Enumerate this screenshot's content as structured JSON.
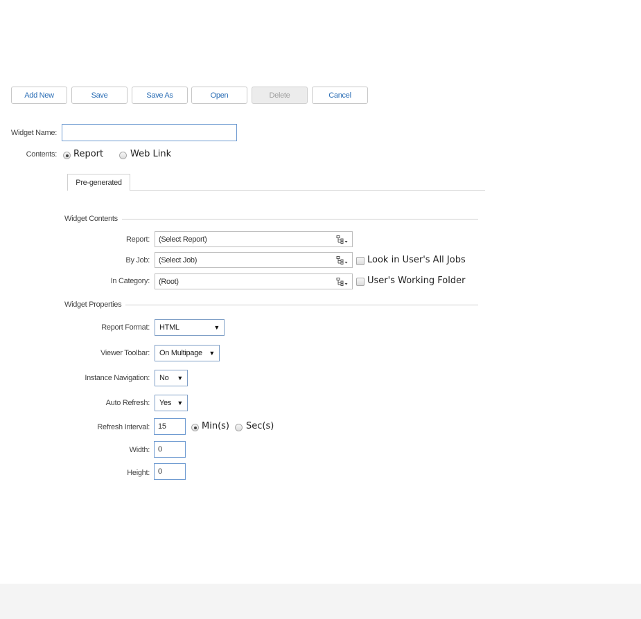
{
  "toolbar": {
    "add_new": "Add New",
    "save": "Save",
    "save_as": "Save As",
    "open": "Open",
    "delete": "Delete",
    "cancel": "Cancel"
  },
  "widget_name": {
    "label": "Widget Name:",
    "value": ""
  },
  "contents": {
    "label": "Contents:",
    "options": [
      "Report",
      "Web Link"
    ],
    "selected": "Report"
  },
  "tabs": {
    "active": "Pre-generated"
  },
  "widget_contents": {
    "title": "Widget Contents",
    "report": {
      "label": "Report:",
      "value": "(Select Report)"
    },
    "by_job": {
      "label": "By Job:",
      "value": "(Select Job)",
      "checkbox_label": "Look in User's All Jobs",
      "checked": false
    },
    "in_category": {
      "label": "In Category:",
      "value": "(Root)",
      "checkbox_label": "User's Working Folder",
      "checked": false
    }
  },
  "widget_properties": {
    "title": "Widget Properties",
    "report_format": {
      "label": "Report Format:",
      "value": "HTML"
    },
    "viewer_toolbar": {
      "label": "Viewer Toolbar:",
      "value": "On Multipage"
    },
    "instance_navigation": {
      "label": "Instance Navigation:",
      "value": "No"
    },
    "auto_refresh": {
      "label": "Auto Refresh:",
      "value": "Yes"
    },
    "refresh_interval": {
      "label": "Refresh Interval:",
      "value": "15",
      "unit_options": [
        "Min(s)",
        "Sec(s)"
      ],
      "unit_selected": "Min(s)"
    },
    "width": {
      "label": "Width:",
      "value": "0"
    },
    "height": {
      "label": "Height:",
      "value": "0"
    }
  },
  "icons": {
    "dropdown_arrow": "▼",
    "tree_picker": "tree-picker-icon"
  }
}
